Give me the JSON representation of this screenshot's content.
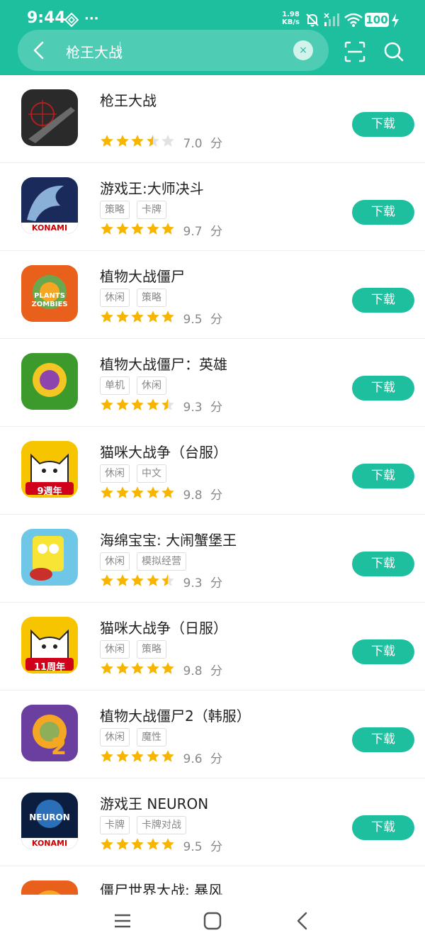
{
  "status": {
    "time": "9:44",
    "speed_value": "1.98",
    "speed_unit": "KB/s",
    "battery": "100"
  },
  "search": {
    "query": "枪王大战",
    "clear_symbol": "×"
  },
  "download_label": "下载",
  "score_unit": "分",
  "colors": {
    "accent": "#1dbf9f",
    "star": "#f7b500",
    "star_empty": "#e2e2e2"
  },
  "apps": [
    {
      "title": "枪王大战",
      "tags": [],
      "rating": 3.5,
      "score": "7.0",
      "icon": "gun-game-icon",
      "icon_colors": [
        "#2a2a2a",
        "#6a6a6a",
        "#b21e1e"
      ]
    },
    {
      "title": "游戏王:大师决斗",
      "tags": [
        "策略",
        "卡牌"
      ],
      "rating": 5,
      "score": "9.7",
      "icon": "yugioh-dragon-icon",
      "icon_text": "KONAMI",
      "icon_colors": [
        "#1a2a5a",
        "#8ab0d8",
        "#ffffff"
      ]
    },
    {
      "title": "植物大战僵尸",
      "tags": [
        "休闲",
        "策略"
      ],
      "rating": 5,
      "score": "9.5",
      "icon": "pvz-zombie-icon",
      "icon_text": "PLANTS ZOMBIES",
      "icon_colors": [
        "#e8601c",
        "#f5a623",
        "#6aa84f"
      ]
    },
    {
      "title": "植物大战僵尸：英雄",
      "tags": [
        "单机",
        "休闲"
      ],
      "rating": 4.5,
      "score": "9.3",
      "icon": "pvz-heroes-icon",
      "icon_colors": [
        "#3c9a2c",
        "#8e44ad",
        "#f3c623"
      ]
    },
    {
      "title": "猫咪大战争（台服）",
      "tags": [
        "休闲",
        "中文"
      ],
      "rating": 5,
      "score": "9.8",
      "icon": "battle-cats-icon",
      "icon_text": "9週年",
      "icon_colors": [
        "#f7c400",
        "#ffffff",
        "#d0021b"
      ]
    },
    {
      "title": "海绵宝宝: 大闹蟹堡王",
      "tags": [
        "休闲",
        "模拟经营"
      ],
      "rating": 4.5,
      "score": "9.3",
      "icon": "spongebob-icon",
      "icon_colors": [
        "#6fc7e8",
        "#f8e435",
        "#c9302c"
      ]
    },
    {
      "title": "猫咪大战争（日服）",
      "tags": [
        "休闲",
        "策略"
      ],
      "rating": 5,
      "score": "9.8",
      "icon": "battle-cats-icon",
      "icon_text": "11周年",
      "icon_colors": [
        "#f7c400",
        "#ffffff",
        "#d0021b"
      ]
    },
    {
      "title": "植物大战僵尸2（韩服）",
      "tags": [
        "休闲",
        "魔性"
      ],
      "rating": 5,
      "score": "9.6",
      "icon": "pvz2-zombie-icon",
      "icon_text": "2",
      "icon_colors": [
        "#6b3fa0",
        "#8fae5a",
        "#f5a623"
      ]
    },
    {
      "title": "游戏王 NEURON",
      "tags": [
        "卡牌",
        "卡牌对战"
      ],
      "rating": 5,
      "score": "9.5",
      "icon": "yugioh-neuron-icon",
      "icon_text": "NEURON",
      "icon_text2": "KONAMI",
      "icon_colors": [
        "#0b1e3f",
        "#2a6fb8",
        "#ffffff"
      ]
    },
    {
      "title": "僵尸世界大战: 暴风",
      "partial": true,
      "icon": "wwz-icon",
      "icon_colors": [
        "#e8601c",
        "#5a2a1a",
        "#f5a623"
      ]
    }
  ]
}
